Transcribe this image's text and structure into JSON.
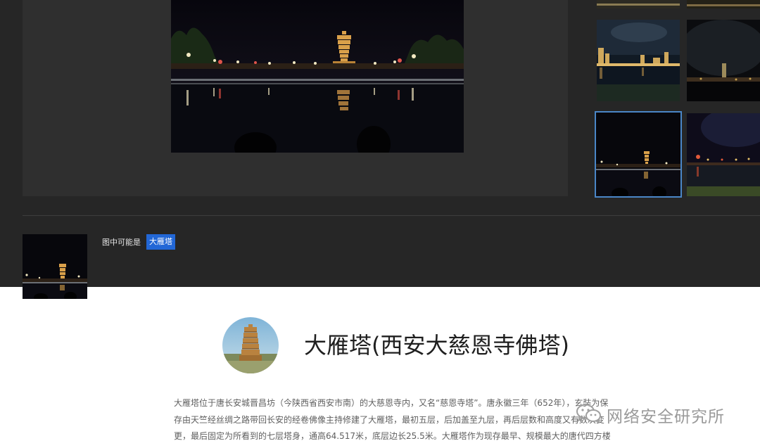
{
  "viewer": {
    "main_image": "nighttime photo of the Big Wild Goose Pagoda lit up behind a reflecting pool"
  },
  "thumbnails": [
    {
      "name": "thumb-top-left",
      "scene": "night skyline strip"
    },
    {
      "name": "thumb-top-right",
      "scene": "night skyline strip"
    },
    {
      "name": "thumb-city-skyline",
      "scene": "city skyline at night across river"
    },
    {
      "name": "thumb-pagoda-distance",
      "scene": "distant pagoda at night"
    },
    {
      "name": "thumb-pagoda-reflection",
      "scene": "pagoda with reflecting pool",
      "selected": true
    },
    {
      "name": "thumb-lakeside-lights",
      "scene": "lakeside lights at night"
    }
  ],
  "result": {
    "label": "图中可能是",
    "tag": "大雁塔"
  },
  "detail": {
    "title": "大雁塔(西安大慈恩寺佛塔)",
    "description_lines": [
      "大雁塔位于唐长安城晋昌坊（今陕西省西安市南）的大慈恩寺内，又名“慈恩寺塔”。唐永徽三年（652年），玄奘为保",
      "存由天竺经丝绸之路带回长安的经卷佛像主持修建了大雁塔，最初五层，后加盖至九层，再后层数和高度又有数次变",
      "更，最后固定为所看到的七层塔身，通高64.517米，底层边长25.5米。大雁塔作为现存最早、规模最大的唐代四方楼"
    ]
  },
  "watermark": {
    "text": "网络安全研究所",
    "icon": "wechat-icon"
  },
  "colors": {
    "dark_bg": "#262626",
    "viewer_bg": "#2f2f2f",
    "tag_bg": "#2267d6",
    "selected_border": "#4a86c7"
  }
}
